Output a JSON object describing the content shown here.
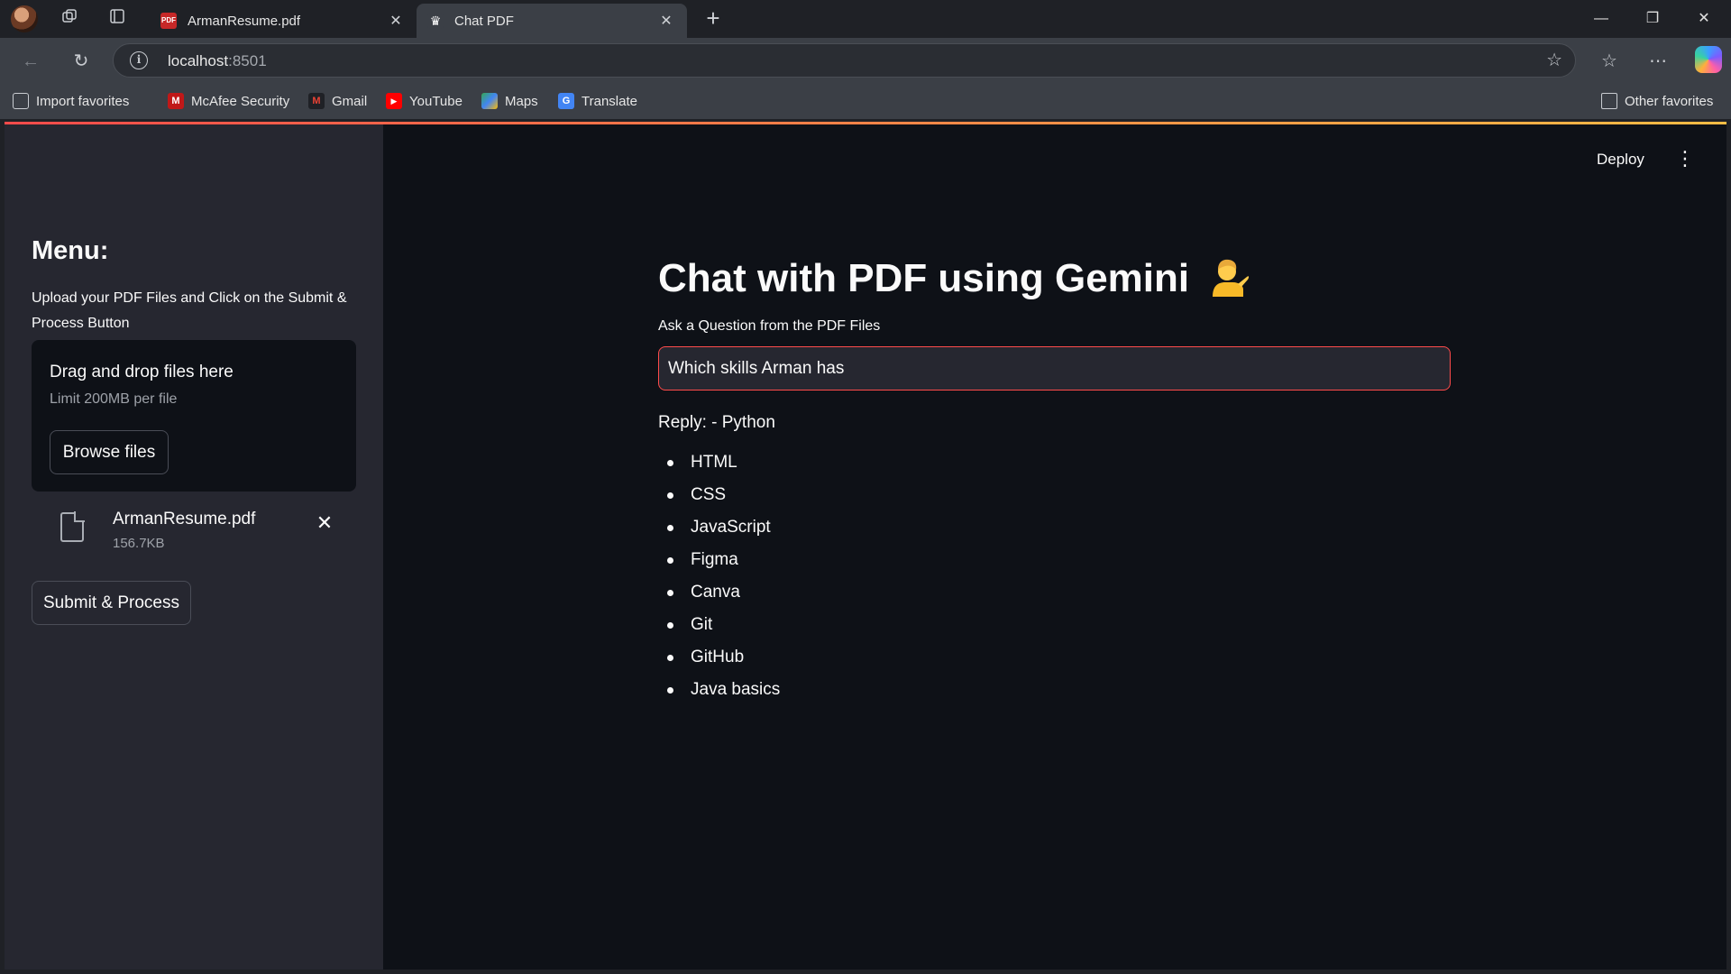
{
  "browser": {
    "tabs": [
      {
        "title": "ArmanResume.pdf",
        "favicon": "pdf-icon",
        "active": false
      },
      {
        "title": "Chat PDF",
        "favicon": "crown-icon",
        "active": true
      }
    ],
    "url": {
      "host": "localhost",
      "port": ":8501"
    },
    "favorites": [
      {
        "label": "Import favorites",
        "icon": "import-icon"
      },
      {
        "label": "McAfee Security",
        "icon": "mcafee-icon"
      },
      {
        "label": "Gmail",
        "icon": "gmail-icon"
      },
      {
        "label": "YouTube",
        "icon": "youtube-icon"
      },
      {
        "label": "Maps",
        "icon": "maps-icon"
      },
      {
        "label": "Translate",
        "icon": "translate-icon"
      }
    ],
    "other_favorites": "Other favorites"
  },
  "sidebar": {
    "title": "Menu:",
    "description": "Upload your PDF Files and Click on the Submit & Process Button",
    "dropzone": {
      "title": "Drag and drop files here",
      "limit": "Limit 200MB per file",
      "browse_label": "Browse files"
    },
    "file": {
      "name": "ArmanResume.pdf",
      "size": "156.7KB"
    },
    "submit_label": "Submit & Process"
  },
  "header": {
    "deploy_label": "Deploy"
  },
  "main": {
    "title": "Chat with PDF using Gemini",
    "question_label": "Ask a Question from the PDF Files",
    "question_value": "Which skills Arman has",
    "reply": "Reply: - Python",
    "skills": [
      "HTML",
      "CSS",
      "JavaScript",
      "Figma",
      "Canva",
      "Git",
      "GitHub",
      "Java basics"
    ]
  },
  "colors": {
    "page_bg": "#0e1117",
    "sidebar_bg": "#262730",
    "accent": "#ff4b4b",
    "text": "#fafafa"
  }
}
